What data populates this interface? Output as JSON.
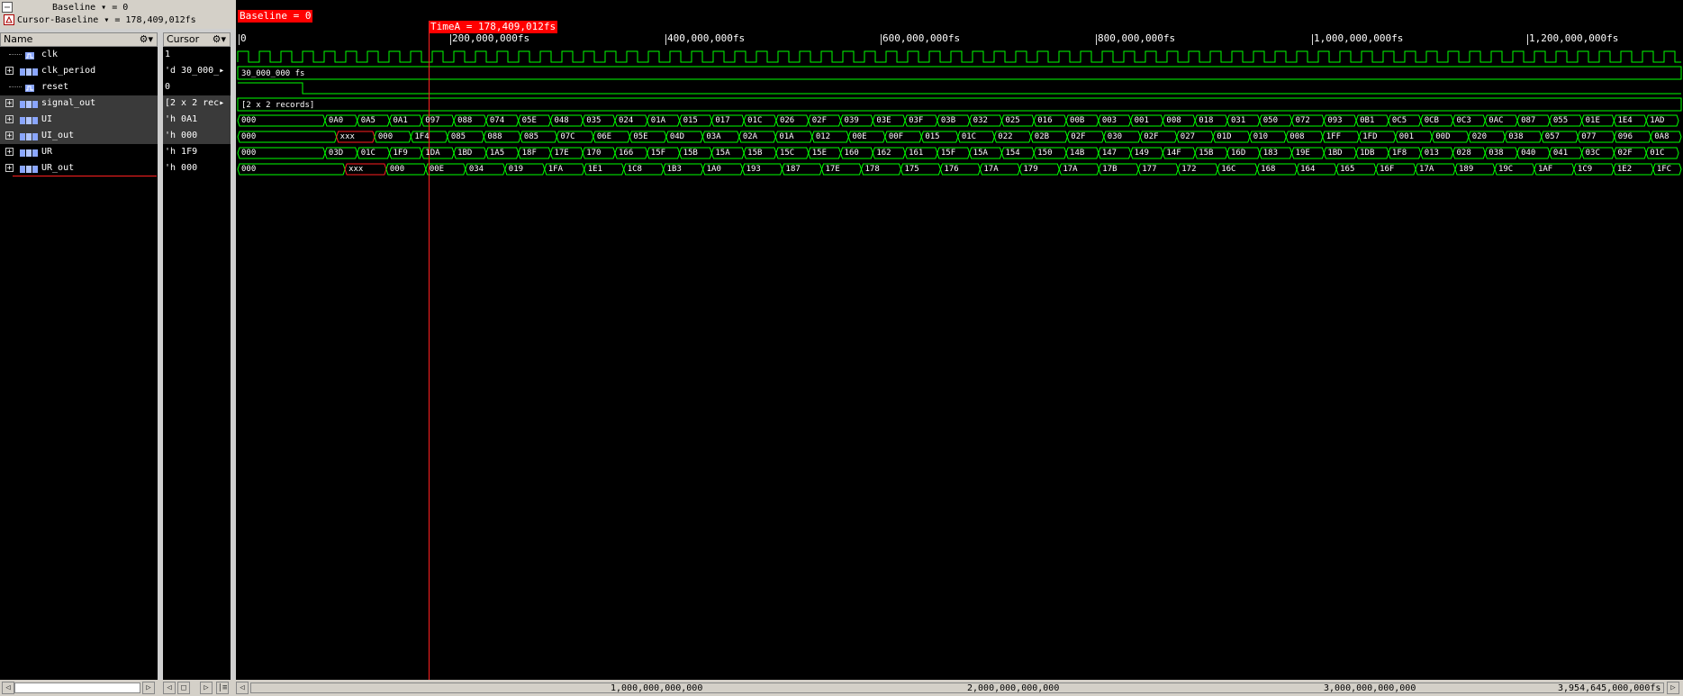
{
  "toolbar": {
    "baseline": "Baseline ▾ = 0",
    "cursor_baseline": "Cursor-Baseline ▾ = 178,409,012fs"
  },
  "columns": {
    "name_header": "Name",
    "cursor_header": "Cursor"
  },
  "signals": [
    {
      "name": "clk",
      "value": "1",
      "expandable": false,
      "selected": false
    },
    {
      "name": "clk_period",
      "value": "'d 30_000_▸",
      "expandable": true,
      "selected": false
    },
    {
      "name": "reset",
      "value": "0",
      "expandable": false,
      "selected": false
    },
    {
      "name": "signal_out",
      "value": "[2 x 2 rec▸",
      "expandable": true,
      "selected": true
    },
    {
      "name": "UI",
      "value": "'h 0A1",
      "expandable": true,
      "selected": true
    },
    {
      "name": "UI_out",
      "value": "'h 000",
      "expandable": true,
      "selected": true
    },
    {
      "name": "UR",
      "value": "'h 1F9",
      "expandable": true,
      "selected": false
    },
    {
      "name": "UR_out",
      "value": "'h 000",
      "expandable": true,
      "selected": false
    }
  ],
  "markers": {
    "baseline_label": "Baseline = 0",
    "timea_label": "TimeA = 178,409,012fs"
  },
  "ruler": [
    "0",
    "200,000,000fs",
    "400,000,000fs",
    "600,000,000fs",
    "800,000,000fs",
    "1,000,000,000fs",
    "1,200,000,000fs"
  ],
  "wave_labels": {
    "clk_period": "30_000_000 fs",
    "signal_out": "[2 x 2 records]",
    "UI": [
      "000",
      "0A0",
      "0A5",
      "0A1",
      "097",
      "088",
      "074",
      "05E",
      "048",
      "035",
      "024",
      "01A",
      "015",
      "017",
      "01C",
      "026",
      "02F",
      "039",
      "03E",
      "03F",
      "03B",
      "032",
      "025",
      "016",
      "00B",
      "003",
      "001",
      "008",
      "018",
      "031",
      "050",
      "072",
      "093",
      "0B1",
      "0C5",
      "0CB",
      "0C3",
      "0AC",
      "087",
      "055",
      "01E",
      "1E4",
      "1AD"
    ],
    "UI_out": [
      "000",
      "xxx",
      "000",
      "1F4",
      "085",
      "088",
      "085",
      "07C",
      "06E",
      "05E",
      "04D",
      "03A",
      "02A",
      "01A",
      "012",
      "00E",
      "00F",
      "015",
      "01C",
      "022",
      "02B",
      "02F",
      "030",
      "02F",
      "027",
      "01D",
      "010",
      "008",
      "1FF",
      "1FD",
      "001",
      "00D",
      "020",
      "038",
      "057",
      "077",
      "096",
      "0A8"
    ],
    "UR": [
      "000",
      "03D",
      "01C",
      "1F9",
      "1DA",
      "1BD",
      "1A5",
      "18F",
      "17E",
      "170",
      "166",
      "15F",
      "15B",
      "15A",
      "15B",
      "15C",
      "15E",
      "160",
      "162",
      "161",
      "15F",
      "15A",
      "154",
      "150",
      "14B",
      "147",
      "149",
      "14F",
      "15B",
      "16D",
      "183",
      "19E",
      "1BD",
      "1DB",
      "1F8",
      "013",
      "028",
      "038",
      "040",
      "041",
      "03C",
      "02F",
      "01C"
    ],
    "UR_out": [
      "000",
      "xxx",
      "000",
      "00E",
      "034",
      "019",
      "1FA",
      "1E1",
      "1C8",
      "1B3",
      "1A0",
      "193",
      "187",
      "17E",
      "178",
      "175",
      "176",
      "17A",
      "179",
      "17A",
      "17B",
      "177",
      "172",
      "16C",
      "168",
      "164",
      "165",
      "16F",
      "17A",
      "189",
      "19C",
      "1AF",
      "1C9",
      "1E2",
      "1FC"
    ]
  },
  "timeline": [
    "1,000,000,000,000",
    "2,000,000,000,000",
    "3,000,000,000,000",
    "3,954,645,000,000fs"
  ],
  "colors": {
    "wave": "#00ff00",
    "cursor": "#ff2020",
    "xxx": "#ff2020",
    "background": "#000000"
  }
}
